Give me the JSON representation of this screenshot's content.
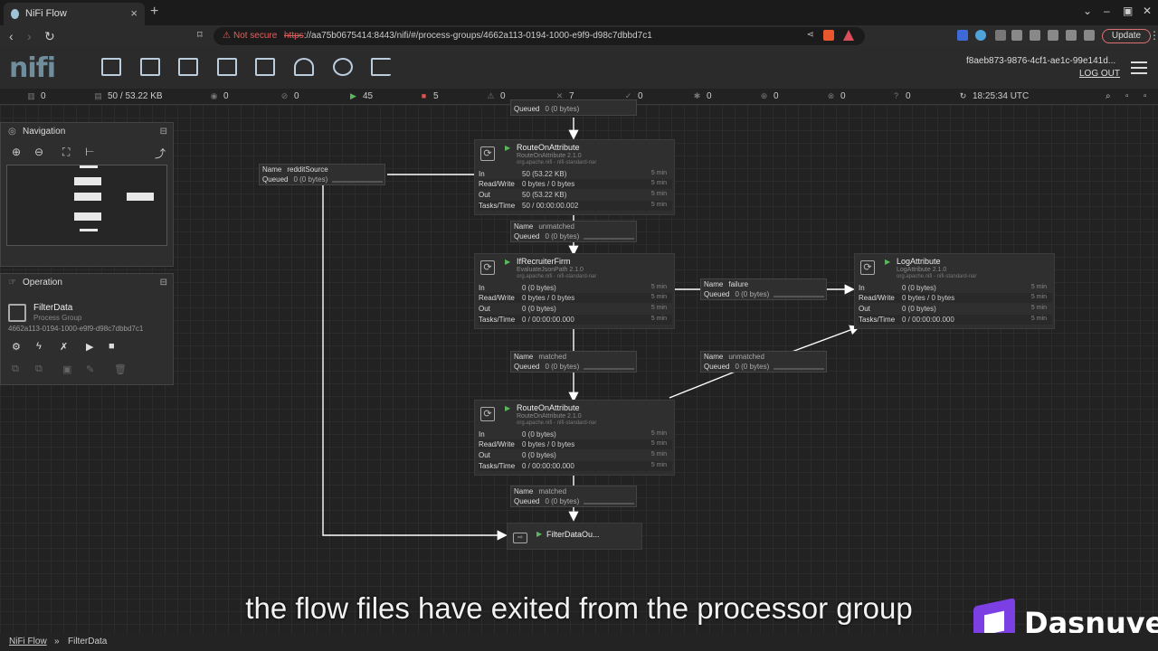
{
  "browser": {
    "tab_title": "NiFi Flow",
    "tab_close": "×",
    "new_tab": "+",
    "not_secure": "Not secure",
    "url_scheme": "https",
    "url_rest": "://aa75b0675414:8443/nifi/#/process-groups/4662a113-0194-1000-e9f9-d98c7dbbd7c1",
    "update_label": "Update"
  },
  "header": {
    "logo": "nifi",
    "user": "f8aeb873-9876-4cf1-ae1c-99e141d...",
    "logout": "LOG OUT"
  },
  "status": {
    "active_threads": "0",
    "queued": "50 / 53.22 KB",
    "transmitting": "0",
    "not_transmitting": "0",
    "running": "45",
    "stopped": "5",
    "invalid": "0",
    "disabled": "7",
    "up_to_date": "0",
    "locally_modified": "0",
    "stale": "0",
    "modified_stale": "0",
    "sync_failure": "0",
    "refreshed": "18:25:34 UTC"
  },
  "navigation": {
    "title": "Navigation"
  },
  "operation": {
    "title": "Operation",
    "name": "FilterData",
    "type": "Process Group",
    "id": "4662a113-0194-1000-e9f9-d98c7dbbd7c1"
  },
  "labels": {
    "name": "Name",
    "queued": "Queued",
    "in": "In",
    "rw": "Read/Write",
    "out": "Out",
    "tasks": "Tasks/Time",
    "time": "5 min"
  },
  "processors": {
    "route1": {
      "name": "RouteOnAttribute",
      "type": "RouteOnAttribute 2.1.0",
      "bundle": "org.apache.nifi - nifi-standard-nar",
      "in": "50 (53.22 KB)",
      "rw": "0 bytes / 0 bytes",
      "out": "50 (53.22 KB)",
      "tasks": "50 / 00:00:00.002"
    },
    "recruiter": {
      "name": "IfRecruiterFirm",
      "type": "EvaluateJsonPath 2.1.0",
      "bundle": "org.apache.nifi - nifi-standard-nar",
      "in": "0 (0 bytes)",
      "rw": "0 bytes / 0 bytes",
      "out": "0 (0 bytes)",
      "tasks": "0 / 00:00:00.000"
    },
    "log": {
      "name": "LogAttribute",
      "type": "LogAttribute 2.1.0",
      "bundle": "org.apache.nifi - nifi-standard-nar",
      "in": "0 (0 bytes)",
      "rw": "0 bytes / 0 bytes",
      "out": "0 (0 bytes)",
      "tasks": "0 / 00:00:00.000"
    },
    "route2": {
      "name": "RouteOnAttribute",
      "type": "RouteOnAttribute 2.1.0",
      "bundle": "org.apache.nifi - nifi-standard-nar",
      "in": "0 (0 bytes)",
      "rw": "0 bytes / 0 bytes",
      "out": "0 (0 bytes)",
      "tasks": "0 / 00:00:00.000"
    }
  },
  "connections": {
    "top": {
      "name": "",
      "queued": "0 (0 bytes)"
    },
    "reddit": {
      "name": "redditSource",
      "queued": "0 (0 bytes)"
    },
    "unmatched1": {
      "name": "unmatched",
      "queued": "0 (0 bytes)"
    },
    "failure": {
      "name": "failure",
      "queued": "0 (0 bytes)"
    },
    "matched1": {
      "name": "matched",
      "queued": "0 (0 bytes)"
    },
    "unmatched2": {
      "name": "unmatched",
      "queued": "0 (0 bytes)"
    },
    "matched2": {
      "name": "matched",
      "queued": "0 (0 bytes)"
    }
  },
  "output_port": {
    "name": "FilterDataOu..."
  },
  "subtitle": "the flow files have exited from the processor group",
  "watermark": "Dasnuve",
  "breadcrumbs": {
    "root": "NiFi Flow",
    "sep": "»",
    "current": "FilterData"
  }
}
